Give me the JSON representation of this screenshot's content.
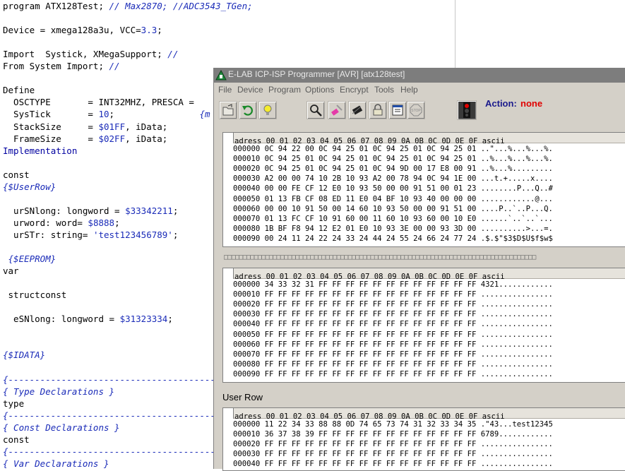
{
  "editor": {
    "lines": [
      {
        "t": "program ATX128Test; ",
        "c": "// Max2870; //ADC3543_TGen;"
      },
      {
        "t": ""
      },
      {
        "t": "Device = xmega128a3u, VCC=",
        "n": "3.3",
        ";": ";"
      },
      {
        "t": ""
      },
      {
        "t": "Import  Systick, XMegaSupport; ",
        "c": "//"
      },
      {
        "t": "From System Import; ",
        "c": "//"
      },
      {
        "t": ""
      },
      {
        "t": "Define"
      },
      {
        "t": "  OSCTYPE       = INT32MHZ, PRESCA ="
      },
      {
        "t": "  SysTick       = ",
        "n": "10",
        ";": ";",
        "c": "                {m"
      },
      {
        "t": "  StackSize     = ",
        "n": "$01FF",
        ";": ", iData;"
      },
      {
        "t": "  FrameSize     = ",
        "n": "$02FF",
        ";": ", iData;"
      },
      {
        "k": "Implementation"
      },
      {
        "t": ""
      },
      {
        "t": "const"
      },
      {
        "c": "{$UserRow}"
      },
      {
        "t": ""
      },
      {
        "t": "  urSNlong: longword = ",
        "n": "$33342211",
        ";": ";"
      },
      {
        "t": "  urword: word= ",
        "n": "$8888",
        ";": ";"
      },
      {
        "t": "  urSTr: string= ",
        "n": "'test123456789'",
        ";": ";"
      },
      {
        "t": ""
      },
      {
        "c": " {$EEPROM}"
      },
      {
        "t": "var"
      },
      {
        "t": ""
      },
      {
        "t": " structconst"
      },
      {
        "t": ""
      },
      {
        "t": "  eSNlong: longword = ",
        "n": "$31323334",
        ";": ";"
      },
      {
        "t": ""
      },
      {
        "t": ""
      },
      {
        "c": "{$IDATA}"
      },
      {
        "t": ""
      },
      {
        "c": "{--------------------------------------------"
      },
      {
        "c": "{ Type Declarations }"
      },
      {
        "t": "type"
      },
      {
        "c": "{--------------------------------------------"
      },
      {
        "c": "{ Const Declarations }"
      },
      {
        "t": "const"
      },
      {
        "c": "{--------------------------------------------"
      },
      {
        "c": "{ Var Declarations }"
      }
    ]
  },
  "programmer": {
    "title": "E-LAB ICP-ISP Programmer [AVR]  [atx128test]",
    "menu": [
      "File",
      "Device",
      "Program",
      "Options",
      "Encrypt",
      "Tools",
      "Help"
    ],
    "toolbar_icons": [
      "open-folder-icon",
      "undo-icon",
      "bulb-icon",
      "inspect-icon",
      "erase-icon",
      "chip-icon",
      "lock-icon",
      "checklist-icon",
      "stop-icon",
      "traffic-light-icon"
    ],
    "action_label": "Action:",
    "action_value": "none",
    "hex_header": "adress 00 01 02 03 04 05 06 07 08 09 0A 0B 0C 0D 0E 0F ascii",
    "flash_rows": [
      "000000 0C 94 22 00 0C 94 25 01 0C 94 25 01 0C 94 25 01 ..\"...%...%...%.",
      "000010 0C 94 25 01 0C 94 25 01 0C 94 25 01 0C 94 25 01 ..%...%...%...%.",
      "000020 0C 94 25 01 0C 94 25 01 0C 94 9D 00 17 E8 00 91 ..%...%.........",
      "000030 A2 00 00 74 10 2B 10 93 A2 00 78 94 0C 94 1E 00 ...t.+.....x....",
      "000040 00 00 FE CF 12 E0 10 93 50 00 00 91 51 00 01 23 ........P...Q..#",
      "000050 01 13 FB CF 08 ED 11 E0 04 BF 10 93 40 00 00 00 ............@...",
      "000060 00 00 10 91 50 00 14 60 10 93 50 00 00 91 51 00 ....P..`..P...Q.",
      "000070 01 13 FC CF 10 91 60 00 11 60 10 93 60 00 10 E0 ......`..`..`...",
      "000080 1B BF F8 94 12 E2 01 E0 10 93 3E 00 00 93 3D 00 ..........>...=.",
      "000090 00 24 11 24 22 24 33 24 44 24 55 24 66 24 77 24 .$.$\"$3$D$U$f$w$"
    ],
    "glyph_bar": "□□□□□□□□□□□□□□□□□□□□□□□□□□□□□□□□□□□□□□□□□□□□□□□□□□□□□□□□□□□□□□□□□□□□□□□□□□□□□□□□□□□",
    "eeprom_rows": [
      "000000 34 33 32 31 FF FF FF FF FF FF FF FF FF FF FF FF 4321............",
      "000010 FF FF FF FF FF FF FF FF FF FF FF FF FF FF FF FF ................",
      "000020 FF FF FF FF FF FF FF FF FF FF FF FF FF FF FF FF ................",
      "000030 FF FF FF FF FF FF FF FF FF FF FF FF FF FF FF FF ................",
      "000040 FF FF FF FF FF FF FF FF FF FF FF FF FF FF FF FF ................",
      "000050 FF FF FF FF FF FF FF FF FF FF FF FF FF FF FF FF ................",
      "000060 FF FF FF FF FF FF FF FF FF FF FF FF FF FF FF FF ................",
      "000070 FF FF FF FF FF FF FF FF FF FF FF FF FF FF FF FF ................",
      "000080 FF FF FF FF FF FF FF FF FF FF FF FF FF FF FF FF ................",
      "000090 FF FF FF FF FF FF FF FF FF FF FF FF FF FF FF FF ................"
    ],
    "user_row_label": "User Row",
    "user_rows": [
      "000000 11 22 34 33 88 88 0D 74 65 73 74 31 32 33 34 35 .\"43...test12345",
      "000010 36 37 38 39 FF FF FF FF FF FF FF FF FF FF FF FF 6789............",
      "000020 FF FF FF FF FF FF FF FF FF FF FF FF FF FF FF FF ................",
      "000030 FF FF FF FF FF FF FF FF FF FF FF FF FF FF FF FF ................",
      "000040 FF FF FF FF FF FF FF FF FF FF FF FF FF FF FF FF ................"
    ]
  }
}
